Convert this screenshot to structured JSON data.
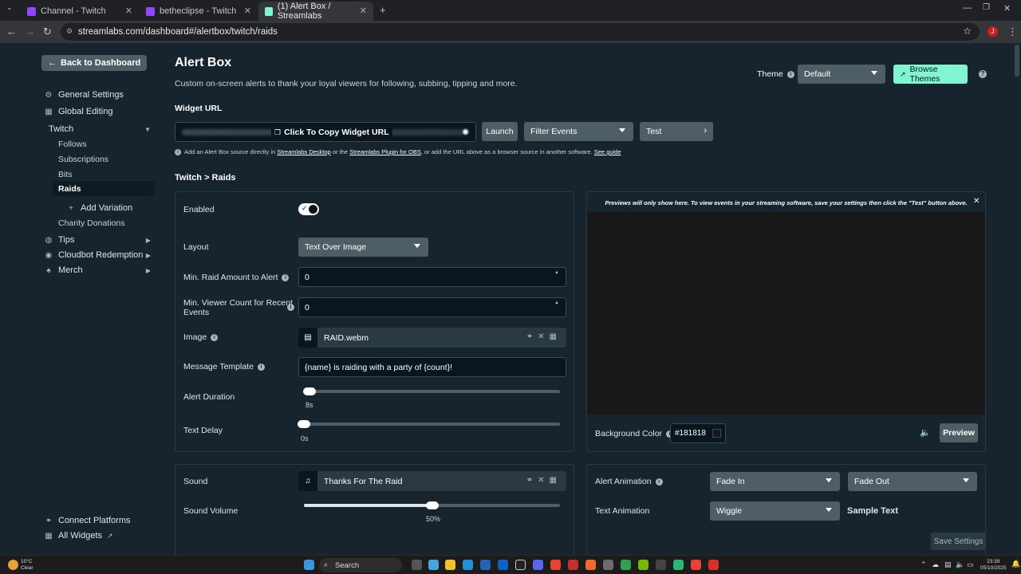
{
  "browser": {
    "tabs": [
      {
        "title": "Channel - Twitch",
        "color": "#9146ff"
      },
      {
        "title": "betheclipse - Twitch",
        "color": "#9146ff"
      },
      {
        "title": "(1) Alert Box / Streamlabs",
        "color": "#80f5d2"
      }
    ],
    "url": "streamlabs.com/dashboard#/alertbox/twitch/raids"
  },
  "sidebar": {
    "back": "Back to Dashboard",
    "general": "General Settings",
    "global": "Global Editing",
    "twitch": "Twitch",
    "sub_items": [
      "Follows",
      "Subscriptions",
      "Bits",
      "Raids"
    ],
    "add_variation": "Add Variation",
    "charity": "Charity Donations",
    "tips": "Tips",
    "cloudbot": "Cloudbot Redemption",
    "merch": "Merch",
    "connect": "Connect Platforms",
    "all_widgets": "All Widgets"
  },
  "header": {
    "title": "Alert Box",
    "subtitle": "Custom on-screen alerts to thank your loyal viewers for following, subbing, tipping and more.",
    "theme_label": "Theme",
    "theme_value": "Default",
    "browse_themes": "Browse Themes"
  },
  "widget": {
    "label": "Widget URL",
    "copy": "Click To Copy Widget URL",
    "launch": "Launch",
    "filter": "Filter Events",
    "test": "Test",
    "note_a": "Add an Alert Box source directly in ",
    "note_link1": "Streamlabs Desktop",
    "note_b": " or the ",
    "note_link2": "Streamlabs Plugin for OBS",
    "note_c": ", or add the URL above as a browser source in another software. ",
    "note_link3": "See guide"
  },
  "breadcrumb": "Twitch > Raids",
  "settings": {
    "enabled": "Enabled",
    "layout": "Layout",
    "layout_value": "Text Over Image",
    "min_raid": "Min. Raid Amount to Alert",
    "min_raid_value": "0",
    "min_viewer_1": "Min. Viewer Count for Recent",
    "min_viewer_2": "Events",
    "min_viewer_value": "0",
    "image": "Image",
    "image_file": "RAID.webm",
    "template": "Message Template",
    "template_value": "{name} is raiding with a party of {count}!",
    "duration": "Alert Duration",
    "duration_value": "8s",
    "text_delay": "Text Delay",
    "text_delay_value": "0s"
  },
  "preview": {
    "notice": "Previews will only show here. To view events in your streaming software, save your settings then click the \"Test\" button above.",
    "bg_label": "Background Color",
    "bg_value": "#181818",
    "preview_btn": "Preview"
  },
  "sound": {
    "label": "Sound",
    "file": "Thanks For The Raid",
    "volume_label": "Sound Volume",
    "volume_value": "50%",
    "volume_fraction": 0.5
  },
  "animation": {
    "alert_label": "Alert Animation",
    "in": "Fade In",
    "out": "Fade Out",
    "text_label": "Text Animation",
    "text_value": "Wiggle",
    "sample": "Sample Text"
  },
  "save": "Save Settings",
  "taskbar": {
    "weather_temp": "10°C",
    "weather_desc": "Clear",
    "search": "Search",
    "time": "23:39",
    "date": "05/10/2025"
  }
}
